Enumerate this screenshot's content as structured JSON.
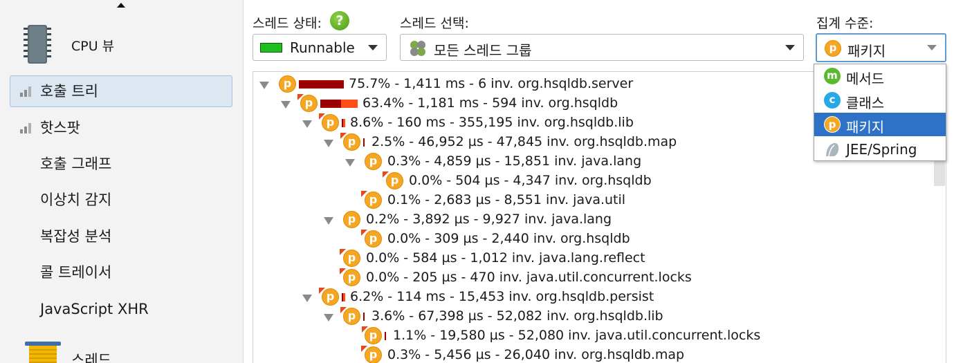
{
  "sidebar": {
    "cpu_view_label": "CPU 뷰",
    "items": [
      {
        "label": "호출 트리"
      },
      {
        "label": "핫스팟"
      },
      {
        "label": "호출 그래프"
      },
      {
        "label": "이상치 감지"
      },
      {
        "label": "복잡성 분석"
      },
      {
        "label": "콜 트레이서"
      },
      {
        "label": "JavaScript XHR"
      }
    ],
    "threads_label": "스레드"
  },
  "toolbar": {
    "thread_status_label": "스레드 상태:",
    "thread_status_value": "Runnable",
    "thread_status_color": "#1fbf1f",
    "thread_selection_label": "스레드 선택:",
    "thread_selection_value": "모든 스레드 그룹",
    "aggregation_label": "집계 수준:",
    "aggregation_value": "패키지",
    "help_icon_text": "?"
  },
  "aggregation_options": [
    {
      "label": "메서드",
      "icon": "m",
      "color": "#5cb82e"
    },
    {
      "label": "클래스",
      "icon": "c",
      "color": "#27a9e8"
    },
    {
      "label": "패키지",
      "icon": "p",
      "color": "#f5a623",
      "selected": true
    },
    {
      "label": "JEE/Spring",
      "icon": "jee-spring-icon",
      "color": "#9aaab0"
    }
  ],
  "tree": {
    "icon_letter": "p",
    "nodes": [
      {
        "text": "75.7% - 1,411 ms - 6 inv. org.hsqldb.server",
        "percent": 75.7,
        "depth": 0,
        "expanded": true
      },
      {
        "text": "63.4% - 1,181 ms - 594 inv. org.hsqldb",
        "percent": 63.4,
        "depth": 1,
        "expanded": true
      },
      {
        "text": "8.6% - 160 ms - 355,195 inv. org.hsqldb.lib",
        "percent": 8.6,
        "depth": 2,
        "expanded": true
      },
      {
        "text": "2.5% - 46,952 µs - 47,845 inv. org.hsqldb.map",
        "percent": 2.5,
        "depth": 3,
        "expanded": true
      },
      {
        "text": "0.3% - 4,859 µs - 15,851 inv. java.lang",
        "percent": 0.3,
        "depth": 4,
        "expanded": true
      },
      {
        "text": "0.0% - 504 µs - 4,347 inv. org.hsqldb",
        "percent": 0.0,
        "depth": 5,
        "expanded": false
      },
      {
        "text": "0.1% - 2,683 µs - 8,551 inv. java.util",
        "percent": 0.1,
        "depth": 4,
        "expanded": false
      },
      {
        "text": "0.2% - 3,892 µs - 9,927 inv. java.lang",
        "percent": 0.2,
        "depth": 3,
        "expanded": true
      },
      {
        "text": "0.0% - 309 µs - 2,440 inv. org.hsqldb",
        "percent": 0.0,
        "depth": 4,
        "expanded": false
      },
      {
        "text": "0.0% - 584 µs - 1,012 inv. java.lang.reflect",
        "percent": 0.0,
        "depth": 3,
        "expanded": false
      },
      {
        "text": "0.0% - 205 µs - 470 inv. java.util.concurrent.locks",
        "percent": 0.0,
        "depth": 3,
        "expanded": false
      },
      {
        "text": "6.2% - 114 ms - 15,453 inv. org.hsqldb.persist",
        "percent": 6.2,
        "depth": 2,
        "expanded": true
      },
      {
        "text": "3.6% - 67,398 µs - 52,082 inv. org.hsqldb.lib",
        "percent": 3.6,
        "depth": 3,
        "expanded": true
      },
      {
        "text": "1.1% - 19,580 µs - 52,080 inv. java.util.concurrent.locks",
        "percent": 1.1,
        "depth": 4,
        "expanded": false
      },
      {
        "text": "0.3% - 5,456 µs - 26,040 inv. org.hsqldb.map",
        "percent": 0.3,
        "depth": 4,
        "expanded": false
      }
    ]
  }
}
